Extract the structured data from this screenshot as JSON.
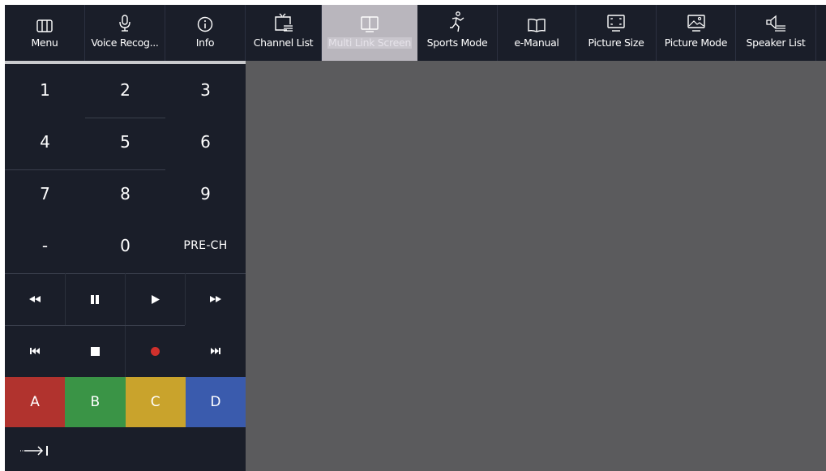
{
  "toolbar": {
    "items": [
      {
        "label": "Menu",
        "icon": "menu-icon"
      },
      {
        "label": "Voice Recog...",
        "icon": "microphone-icon"
      },
      {
        "label": "Info",
        "icon": "info-icon"
      },
      {
        "label": "Channel List",
        "icon": "channel-list-icon"
      },
      {
        "label": "Multi Link Screen",
        "icon": "multi-link-screen-icon",
        "active": true
      },
      {
        "label": "Sports Mode",
        "icon": "sports-mode-icon"
      },
      {
        "label": "e-Manual",
        "icon": "book-icon"
      },
      {
        "label": "Picture Size",
        "icon": "picture-size-icon"
      },
      {
        "label": "Picture Mode",
        "icon": "picture-mode-icon"
      },
      {
        "label": "Speaker List",
        "icon": "speaker-icon"
      }
    ]
  },
  "keypad": {
    "digits": [
      "1",
      "2",
      "3",
      "4",
      "5",
      "6",
      "7",
      "8",
      "9"
    ],
    "dash": "-",
    "zero": "0",
    "pre_ch": "PRE-CH"
  },
  "color_keys": [
    "A",
    "B",
    "C",
    "D"
  ],
  "colors": {
    "panel": "#1a1e29",
    "screen": "#5b5b5d",
    "red": "#b1332e",
    "green": "#3a9446",
    "yellow": "#c9a32c",
    "blue": "#3a5bad",
    "record": "#d0302c"
  }
}
